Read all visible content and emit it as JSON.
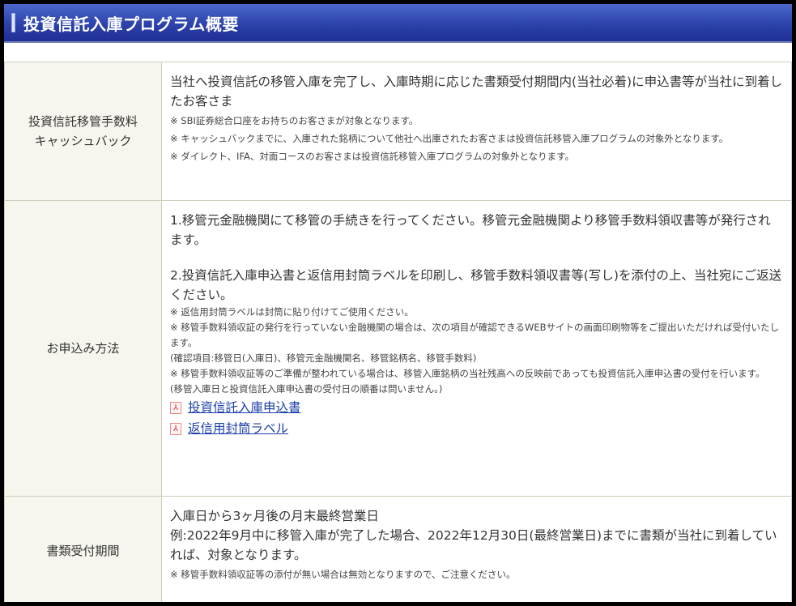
{
  "header": {
    "title": "投資信託入庫プログラム概要"
  },
  "rows": [
    {
      "label": "投資信託移管手数料\nキャッシュバック",
      "label1": "投資信託移管手数料",
      "label2": "キャッシュバック",
      "main": "当社へ投資信託の移管入庫を完了し、入庫時期に応じた書類受付期間内(当社必着)に申込書等が当社に到着したお客さま",
      "notes": [
        "※ SBI証券総合口座をお持ちのお客さまが対象となります。",
        "※ キャッシュバックまでに、入庫された銘柄について他社へ出庫されたお客さまは投資信託移管入庫プログラムの対象外となります。",
        "※ ダイレクト、IFA、対面コースのお客さまは投資信託移管入庫プログラムの対象外となります。"
      ]
    },
    {
      "label": "お申込み方法",
      "step1": "1.移管元金融機関にて移管の手続きを行ってください。移管元金融機関より移管手数料領収書等が発行されます。",
      "step2": "2.投資信託入庫申込書と返信用封筒ラベルを印刷し、移管手数料領収書等(写し)を添付の上、当社宛にご返送ください。",
      "notes": [
        "※ 返信用封筒ラベルは封筒に貼り付けてご使用ください。",
        "※ 移管手数料領収証の発行を行っていない金融機関の場合は、次の項目が確認できるWEBサイトの画面印刷物等をご提出いただければ受付いたします。",
        "(確認項目:移管日(入庫日)、移管元金融機関名、移管銘柄名、移管手数料)",
        "※ 移管手数料領収証等のご準備が整われている場合は、移管入庫銘柄の当社残高への反映前であっても投資信託入庫申込書の受付を行います。",
        "(移管入庫日と投資信託入庫申込書の受付日の順番は問いません。)"
      ],
      "links": [
        {
          "label": "投資信託入庫申込書",
          "icon": "pdf-icon"
        },
        {
          "label": "返信用封筒ラベル",
          "icon": "pdf-icon"
        }
      ]
    },
    {
      "label": "書類受付期間",
      "main1": "入庫日から3ヶ月後の月末最終営業日",
      "main2": "例:2022年9月中に移管入庫が完了した場合、2022年12月30日(最終営業日)までに書類が当社に到着していれば、対象となります。",
      "notes": [
        "※ 移管手数料領収証等の添付が無い場合は無効となりますので、ご注意ください。"
      ]
    }
  ]
}
